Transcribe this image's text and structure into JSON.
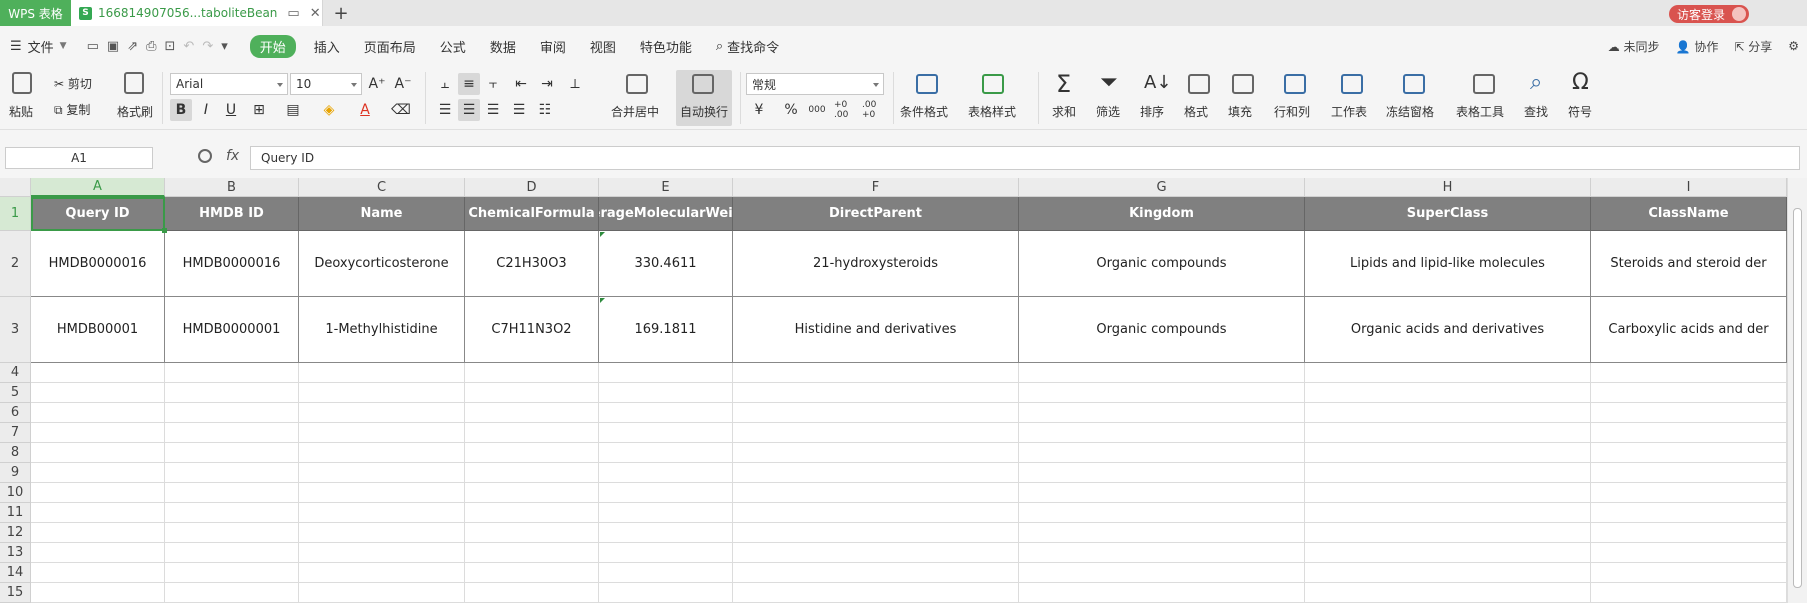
{
  "tabs": {
    "app": "WPS 表格",
    "doc": "166814907056...taboliteBean",
    "new": "+"
  },
  "login": "访客登录",
  "menu": {
    "file": "文件",
    "items": [
      "开始",
      "插入",
      "页面布局",
      "公式",
      "数据",
      "审阅",
      "视图",
      "特色功能"
    ],
    "search": "查找命令",
    "right": [
      "未同步",
      "协作",
      "分享"
    ]
  },
  "ribbon": {
    "paste": "粘贴",
    "cut": "剪切",
    "copy": "复制",
    "format_painter": "格式刷",
    "font": "Arial",
    "size": "10",
    "merge": "合并居中",
    "wrap": "自动换行",
    "number_format": "常规",
    "cond_format": "条件格式",
    "table_style": "表格样式",
    "sum": "求和",
    "filter": "筛选",
    "sort": "排序",
    "format": "格式",
    "fill": "填充",
    "rowcol": "行和列",
    "sheet": "工作表",
    "freeze": "冻结窗格",
    "table_tools": "表格工具",
    "find": "查找",
    "symbol": "符号",
    "pct": "%",
    "thousands": "000",
    "inc_dec": "+0 .00",
    "dec_dec": ".00 +0"
  },
  "formula": {
    "cell_ref": "A1",
    "fx": "fx",
    "value": "Query ID"
  },
  "columns": [
    "A",
    "B",
    "C",
    "D",
    "E",
    "F",
    "G",
    "H",
    "I"
  ],
  "rows": [
    "1",
    "2",
    "3",
    "4",
    "5",
    "6",
    "7",
    "8",
    "9",
    "10",
    "11",
    "12",
    "13",
    "14",
    "15"
  ],
  "sheet": {
    "headers": [
      "Query ID",
      "HMDB ID",
      "Name",
      "ChemicalFormula",
      "AverageMolecularWeight",
      "DirectParent",
      "Kingdom",
      "SuperClass",
      "ClassName"
    ],
    "data": [
      [
        "HMDB0000016",
        "HMDB0000016",
        "Deoxycorticosterone",
        "C21H30O3",
        "330.4611",
        "21-hydroxysteroids",
        "Organic compounds",
        "Lipids and lipid-like molecules",
        "Steroids and steroid der"
      ],
      [
        "HMDB00001",
        "HMDB0000001",
        "1-Methylhistidine",
        "C7H11N3O2",
        "169.1811",
        "Histidine and derivatives",
        "Organic compounds",
        "Organic acids and derivatives",
        "Carboxylic acids and der"
      ]
    ]
  }
}
